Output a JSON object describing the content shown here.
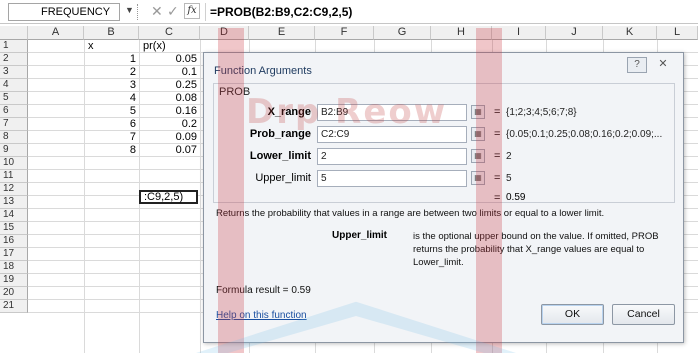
{
  "formula_bar": {
    "name_box": "FREQUENCY",
    "cancel_icon": "✕",
    "enter_icon": "✓",
    "fx_label": "fx",
    "formula": "=PROB(B2:B9,C2:C9,2,5)"
  },
  "columns": [
    "A",
    "B",
    "C",
    "D",
    "E",
    "F",
    "G",
    "H",
    "I",
    "J",
    "K",
    "L"
  ],
  "rows": [
    "1",
    "2",
    "3",
    "4",
    "5",
    "6",
    "7",
    "8",
    "9",
    "10",
    "11",
    "12",
    "13",
    "14",
    "15",
    "16",
    "17",
    "18",
    "19",
    "20",
    "21"
  ],
  "sheet": {
    "header_x": "x",
    "header_px": "pr(x)",
    "x_values": [
      "1",
      "2",
      "3",
      "4",
      "5",
      "6",
      "7",
      "8"
    ],
    "p_values": [
      "0.05",
      "0.1",
      "0.25",
      "0.08",
      "0.16",
      "0.2",
      "0.09",
      "0.07"
    ],
    "editing_cell": ":C9,2,5)"
  },
  "dialog": {
    "title": "Function Arguments",
    "help_button": "?",
    "close_button": "✕",
    "function_name": "PROB",
    "args": [
      {
        "label": "X_range",
        "bold": true,
        "input": "B2:B9",
        "value": "{1;2;3;4;5;6;7;8}"
      },
      {
        "label": "Prob_range",
        "bold": true,
        "input": "C2:C9",
        "value": "{0.05;0.1;0.25;0.08;0.16;0.2;0.09;..."
      },
      {
        "label": "Lower_limit",
        "bold": true,
        "input": "2",
        "value": "2"
      },
      {
        "label": "Upper_limit",
        "bold": false,
        "input": "5",
        "value": "5"
      }
    ],
    "equals": "=",
    "result": "0.59",
    "description": "Returns the probability that values in a range are between two limits or equal to a lower limit.",
    "arg_desc_name": "Upper_limit",
    "arg_desc_text": "is the optional upper bound on the value. If omitted, PROB returns the probability that X_range values are equal to Lower_limit.",
    "formula_result_label": "Formula result =",
    "formula_result_value": "0.59",
    "help_link": "Help on this function",
    "ok_button": "OK",
    "cancel_button": "Cancel"
  },
  "watermark": {
    "text": "Drp Reow"
  }
}
